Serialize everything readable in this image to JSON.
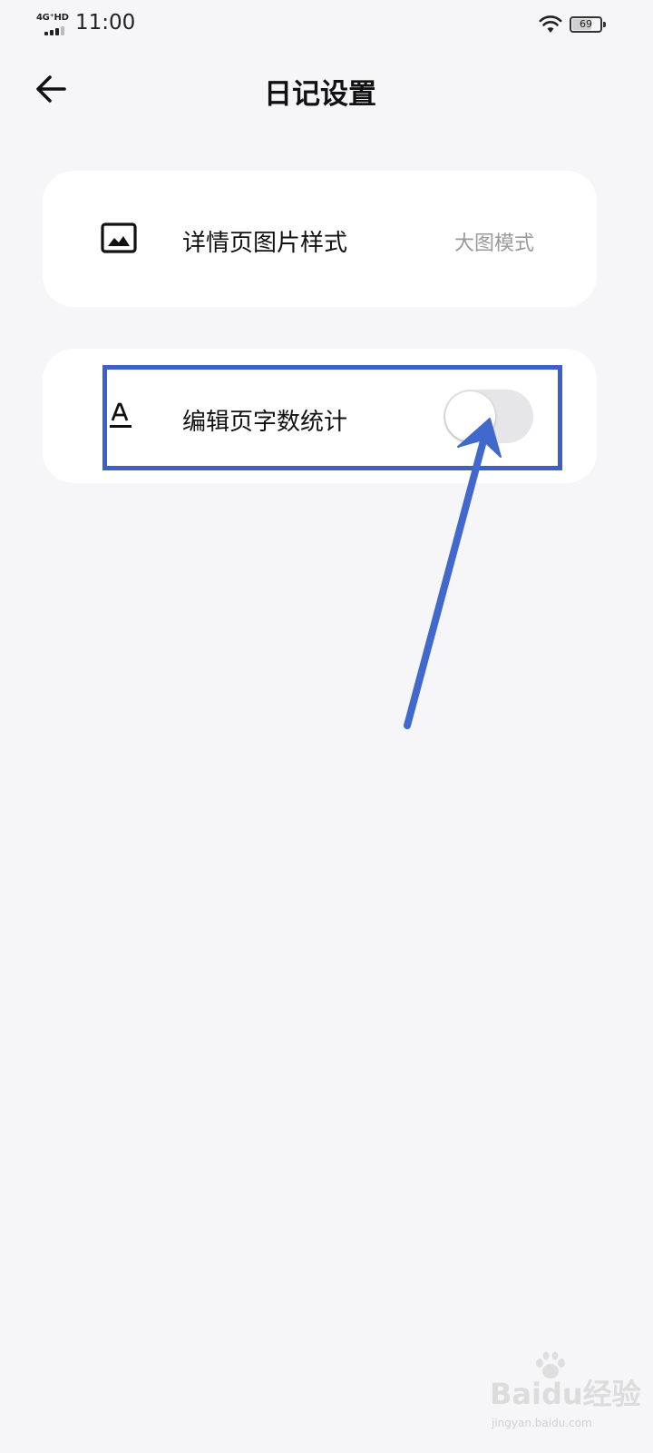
{
  "status_bar": {
    "network": "4G⁺HD",
    "time": "11:00",
    "battery": "69",
    "battery_level": 0.69
  },
  "header": {
    "back_icon": "arrow-left-icon",
    "title": "日记设置"
  },
  "settings": {
    "image_style": {
      "icon": "image-icon",
      "label": "详情页图片样式",
      "value": "大图模式"
    },
    "word_count": {
      "icon": "text-format-icon",
      "label": "编辑页字数统计",
      "enabled": false
    }
  },
  "annotation": {
    "highlight_color": "#3e5fc8",
    "arrow_color": "#3e5fc8"
  },
  "watermark": {
    "text": "Baidu经验",
    "url_text": "jingyan.baidu.com"
  }
}
